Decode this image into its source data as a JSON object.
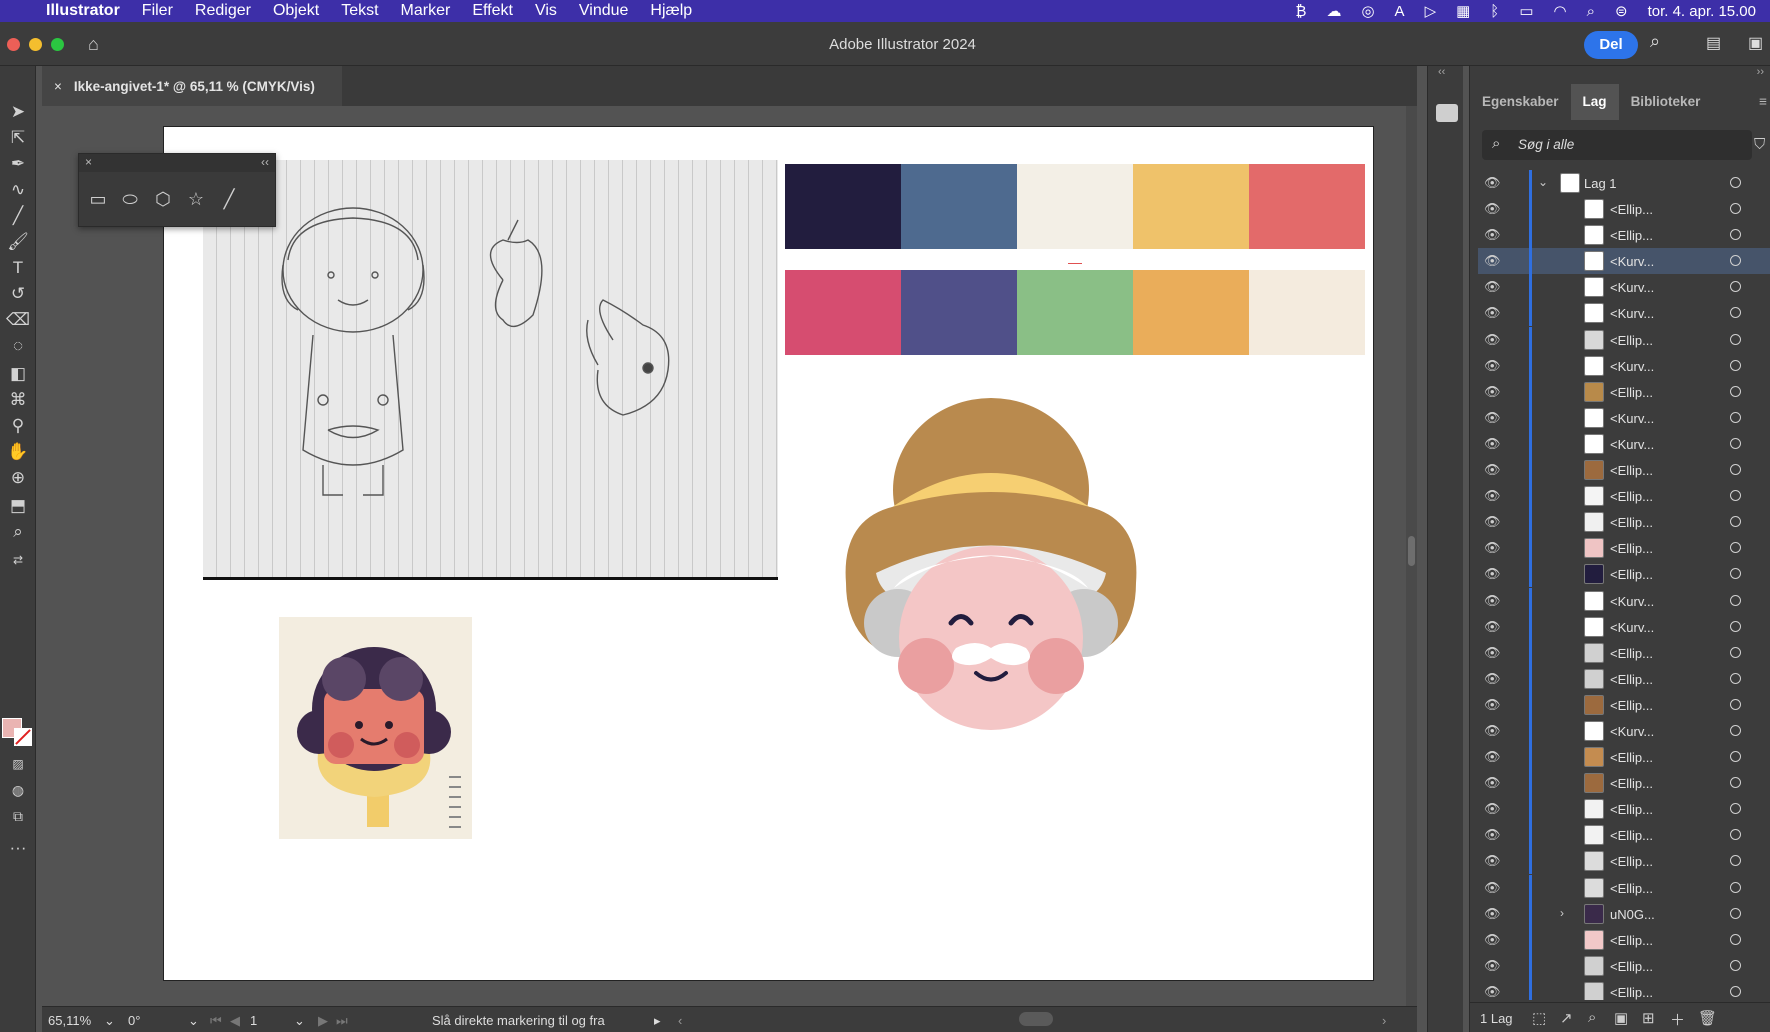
{
  "menubar": {
    "app": "Illustrator",
    "items": [
      "Filer",
      "Rediger",
      "Objekt",
      "Tekst",
      "Marker",
      "Effekt",
      "Vis",
      "Vindue",
      "Hjælp"
    ],
    "datetime": "tor. 4. apr. 15.00"
  },
  "titlebar": {
    "title": "Adobe Illustrator 2024",
    "share_label": "Del"
  },
  "document": {
    "tab_title": "Ikke-angivet-1* @ 65,11 % (CMYK/Vis)"
  },
  "palettes": {
    "row1": [
      "#221d3e",
      "#4e6a8f",
      "#f3efe6",
      "#efc26a",
      "#e36a6a"
    ],
    "row2": [
      "#d64d70",
      "#505089",
      "#8abf86",
      "#eaad5a",
      "#f4ebde"
    ]
  },
  "status": {
    "zoom": "65,11%",
    "rotation": "0°",
    "artboard": "1",
    "message": "Slå direkte markering til og fra"
  },
  "panel": {
    "tabs": [
      "Egenskaber",
      "Lag",
      "Biblioteker"
    ],
    "active_tab": "Lag",
    "search_placeholder": "Søg i alle",
    "layer_count": "1 Lag"
  },
  "layers": [
    {
      "name": "Lag 1",
      "type": "layer",
      "thumb": "#ffffff"
    },
    {
      "name": "<Ellip...",
      "thumb": "#ffffff"
    },
    {
      "name": "<Ellip...",
      "thumb": "#ffffff"
    },
    {
      "name": "<Kurv...",
      "thumb": "#ffffff",
      "selected": true
    },
    {
      "name": "<Kurv...",
      "thumb": "#ffffff"
    },
    {
      "name": "<Kurv...",
      "thumb": "#ffffff"
    },
    {
      "name": "<Ellip...",
      "thumb": "#d8d8d8"
    },
    {
      "name": "<Kurv...",
      "thumb": "#ffffff"
    },
    {
      "name": "<Ellip...",
      "thumb": "#b88a4a"
    },
    {
      "name": "<Kurv...",
      "thumb": "#ffffff"
    },
    {
      "name": "<Kurv...",
      "thumb": "#ffffff"
    },
    {
      "name": "<Ellip...",
      "thumb": "#9c6a3e"
    },
    {
      "name": "<Ellip...",
      "thumb": "#f4f4f4"
    },
    {
      "name": "<Ellip...",
      "thumb": "#f0f0f0"
    },
    {
      "name": "<Ellip...",
      "thumb": "#efc4c4"
    },
    {
      "name": "<Ellip...",
      "thumb": "#221d3e"
    },
    {
      "name": "<Kurv...",
      "thumb": "#ffffff"
    },
    {
      "name": "<Kurv...",
      "thumb": "#ffffff"
    },
    {
      "name": "<Ellip...",
      "thumb": "#d0d0d0"
    },
    {
      "name": "<Ellip...",
      "thumb": "#d0d0d0"
    },
    {
      "name": "<Ellip...",
      "thumb": "#9c6a3e"
    },
    {
      "name": "<Kurv...",
      "thumb": "#ffffff"
    },
    {
      "name": "<Ellip...",
      "thumb": "#c48c50"
    },
    {
      "name": "<Ellip...",
      "thumb": "#9c6a3e"
    },
    {
      "name": "<Ellip...",
      "thumb": "#f2f2f2"
    },
    {
      "name": "<Ellip...",
      "thumb": "#f2f2f2"
    },
    {
      "name": "<Ellip...",
      "thumb": "#dcdcdc"
    },
    {
      "name": "<Ellip...",
      "thumb": "#dcdcdc"
    },
    {
      "name": "uN0G...",
      "type": "group",
      "thumb": "#3a2a4a"
    },
    {
      "name": "<Ellip...",
      "thumb": "#f1c8c8"
    },
    {
      "name": "<Ellip...",
      "thumb": "#d0d0d0"
    },
    {
      "name": "<Ellip...",
      "thumb": "#d0d0d0"
    }
  ]
}
